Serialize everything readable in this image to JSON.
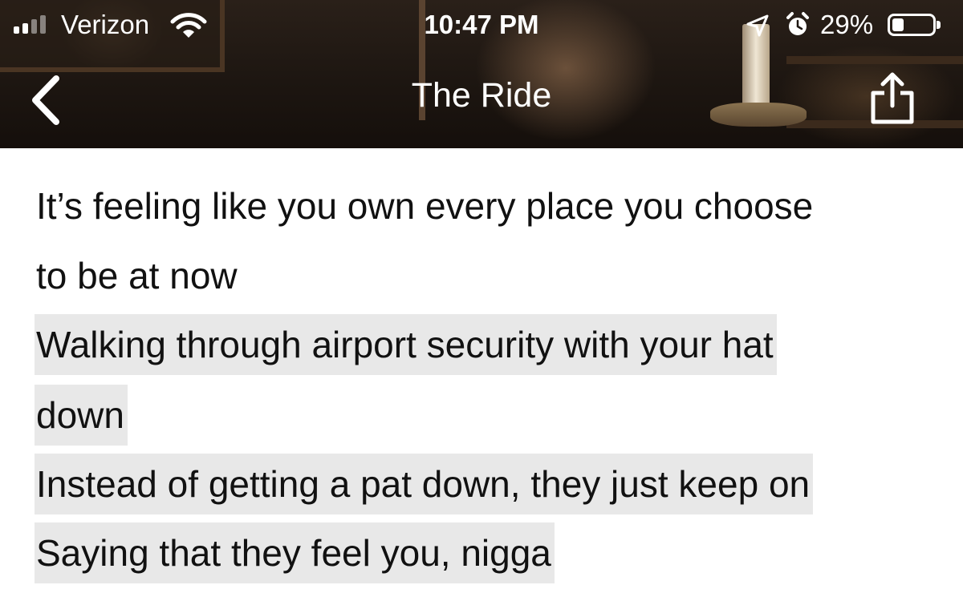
{
  "status_bar": {
    "carrier": "Verizon",
    "time": "10:47 PM",
    "battery_percent": "29%",
    "battery_level": 0.29,
    "signal_bars_filled": 2,
    "signal_bars_total": 4,
    "icons": [
      "signal-icon",
      "wifi-icon",
      "location-arrow-icon",
      "alarm-icon",
      "battery-icon"
    ]
  },
  "nav": {
    "title": "The Ride",
    "back_icon": "chevron-left-icon",
    "share_icon": "share-icon"
  },
  "lyrics": {
    "lines": [
      {
        "text": "It’s feeling like you own every place you choose",
        "highlighted": false
      },
      {
        "text": "to be at now",
        "highlighted": false
      },
      {
        "text": "Walking through airport security with your hat",
        "highlighted": true
      },
      {
        "text": "down",
        "highlighted": true
      },
      {
        "text": "Instead of getting a pat down, they just keep on",
        "highlighted": true
      },
      {
        "text": "Saying that they feel you, nigga",
        "highlighted": true
      }
    ]
  },
  "colors": {
    "highlight": "#e8e8e8",
    "text": "#111111",
    "header_text": "#ffffff"
  }
}
